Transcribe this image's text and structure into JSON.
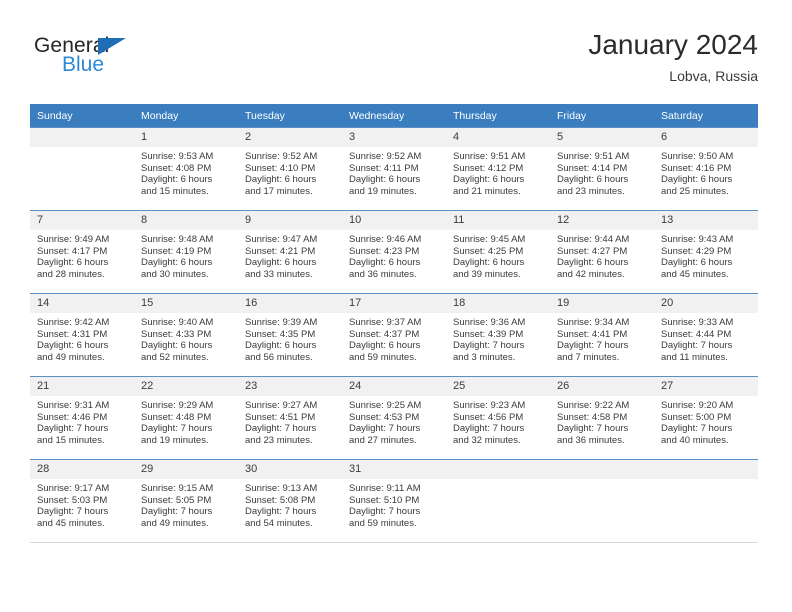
{
  "brand": {
    "word_one": "General",
    "word_two": "Blue",
    "triangle_color": "#1f6db5",
    "blue_color": "#2d89d6"
  },
  "header": {
    "title": "January 2024",
    "subtitle": "Lobva, Russia"
  },
  "theme": {
    "header_blue": "#3a7ec0",
    "daynum_gray": "#f1f1f1",
    "row_rule": "#5b8fc7"
  },
  "weekday_headers": [
    "Sunday",
    "Monday",
    "Tuesday",
    "Wednesday",
    "Thursday",
    "Friday",
    "Saturday"
  ],
  "labels": {
    "sunrise_prefix": "Sunrise:",
    "sunset_prefix": "Sunset:",
    "daylight_prefix": "Daylight:"
  },
  "weeks": [
    [
      {
        "day": "",
        "sunrise": "",
        "sunset": "",
        "daylight_line1": "",
        "daylight_line2": "",
        "empty": true
      },
      {
        "day": "1",
        "sunrise": "Sunrise: 9:53 AM",
        "sunset": "Sunset: 4:08 PM",
        "daylight_line1": "Daylight: 6 hours",
        "daylight_line2": "and 15 minutes."
      },
      {
        "day": "2",
        "sunrise": "Sunrise: 9:52 AM",
        "sunset": "Sunset: 4:10 PM",
        "daylight_line1": "Daylight: 6 hours",
        "daylight_line2": "and 17 minutes."
      },
      {
        "day": "3",
        "sunrise": "Sunrise: 9:52 AM",
        "sunset": "Sunset: 4:11 PM",
        "daylight_line1": "Daylight: 6 hours",
        "daylight_line2": "and 19 minutes."
      },
      {
        "day": "4",
        "sunrise": "Sunrise: 9:51 AM",
        "sunset": "Sunset: 4:12 PM",
        "daylight_line1": "Daylight: 6 hours",
        "daylight_line2": "and 21 minutes."
      },
      {
        "day": "5",
        "sunrise": "Sunrise: 9:51 AM",
        "sunset": "Sunset: 4:14 PM",
        "daylight_line1": "Daylight: 6 hours",
        "daylight_line2": "and 23 minutes."
      },
      {
        "day": "6",
        "sunrise": "Sunrise: 9:50 AM",
        "sunset": "Sunset: 4:16 PM",
        "daylight_line1": "Daylight: 6 hours",
        "daylight_line2": "and 25 minutes."
      }
    ],
    [
      {
        "day": "7",
        "sunrise": "Sunrise: 9:49 AM",
        "sunset": "Sunset: 4:17 PM",
        "daylight_line1": "Daylight: 6 hours",
        "daylight_line2": "and 28 minutes."
      },
      {
        "day": "8",
        "sunrise": "Sunrise: 9:48 AM",
        "sunset": "Sunset: 4:19 PM",
        "daylight_line1": "Daylight: 6 hours",
        "daylight_line2": "and 30 minutes."
      },
      {
        "day": "9",
        "sunrise": "Sunrise: 9:47 AM",
        "sunset": "Sunset: 4:21 PM",
        "daylight_line1": "Daylight: 6 hours",
        "daylight_line2": "and 33 minutes."
      },
      {
        "day": "10",
        "sunrise": "Sunrise: 9:46 AM",
        "sunset": "Sunset: 4:23 PM",
        "daylight_line1": "Daylight: 6 hours",
        "daylight_line2": "and 36 minutes."
      },
      {
        "day": "11",
        "sunrise": "Sunrise: 9:45 AM",
        "sunset": "Sunset: 4:25 PM",
        "daylight_line1": "Daylight: 6 hours",
        "daylight_line2": "and 39 minutes."
      },
      {
        "day": "12",
        "sunrise": "Sunrise: 9:44 AM",
        "sunset": "Sunset: 4:27 PM",
        "daylight_line1": "Daylight: 6 hours",
        "daylight_line2": "and 42 minutes."
      },
      {
        "day": "13",
        "sunrise": "Sunrise: 9:43 AM",
        "sunset": "Sunset: 4:29 PM",
        "daylight_line1": "Daylight: 6 hours",
        "daylight_line2": "and 45 minutes."
      }
    ],
    [
      {
        "day": "14",
        "sunrise": "Sunrise: 9:42 AM",
        "sunset": "Sunset: 4:31 PM",
        "daylight_line1": "Daylight: 6 hours",
        "daylight_line2": "and 49 minutes."
      },
      {
        "day": "15",
        "sunrise": "Sunrise: 9:40 AM",
        "sunset": "Sunset: 4:33 PM",
        "daylight_line1": "Daylight: 6 hours",
        "daylight_line2": "and 52 minutes."
      },
      {
        "day": "16",
        "sunrise": "Sunrise: 9:39 AM",
        "sunset": "Sunset: 4:35 PM",
        "daylight_line1": "Daylight: 6 hours",
        "daylight_line2": "and 56 minutes."
      },
      {
        "day": "17",
        "sunrise": "Sunrise: 9:37 AM",
        "sunset": "Sunset: 4:37 PM",
        "daylight_line1": "Daylight: 6 hours",
        "daylight_line2": "and 59 minutes."
      },
      {
        "day": "18",
        "sunrise": "Sunrise: 9:36 AM",
        "sunset": "Sunset: 4:39 PM",
        "daylight_line1": "Daylight: 7 hours",
        "daylight_line2": "and 3 minutes."
      },
      {
        "day": "19",
        "sunrise": "Sunrise: 9:34 AM",
        "sunset": "Sunset: 4:41 PM",
        "daylight_line1": "Daylight: 7 hours",
        "daylight_line2": "and 7 minutes."
      },
      {
        "day": "20",
        "sunrise": "Sunrise: 9:33 AM",
        "sunset": "Sunset: 4:44 PM",
        "daylight_line1": "Daylight: 7 hours",
        "daylight_line2": "and 11 minutes."
      }
    ],
    [
      {
        "day": "21",
        "sunrise": "Sunrise: 9:31 AM",
        "sunset": "Sunset: 4:46 PM",
        "daylight_line1": "Daylight: 7 hours",
        "daylight_line2": "and 15 minutes."
      },
      {
        "day": "22",
        "sunrise": "Sunrise: 9:29 AM",
        "sunset": "Sunset: 4:48 PM",
        "daylight_line1": "Daylight: 7 hours",
        "daylight_line2": "and 19 minutes."
      },
      {
        "day": "23",
        "sunrise": "Sunrise: 9:27 AM",
        "sunset": "Sunset: 4:51 PM",
        "daylight_line1": "Daylight: 7 hours",
        "daylight_line2": "and 23 minutes."
      },
      {
        "day": "24",
        "sunrise": "Sunrise: 9:25 AM",
        "sunset": "Sunset: 4:53 PM",
        "daylight_line1": "Daylight: 7 hours",
        "daylight_line2": "and 27 minutes."
      },
      {
        "day": "25",
        "sunrise": "Sunrise: 9:23 AM",
        "sunset": "Sunset: 4:56 PM",
        "daylight_line1": "Daylight: 7 hours",
        "daylight_line2": "and 32 minutes."
      },
      {
        "day": "26",
        "sunrise": "Sunrise: 9:22 AM",
        "sunset": "Sunset: 4:58 PM",
        "daylight_line1": "Daylight: 7 hours",
        "daylight_line2": "and 36 minutes."
      },
      {
        "day": "27",
        "sunrise": "Sunrise: 9:20 AM",
        "sunset": "Sunset: 5:00 PM",
        "daylight_line1": "Daylight: 7 hours",
        "daylight_line2": "and 40 minutes."
      }
    ],
    [
      {
        "day": "28",
        "sunrise": "Sunrise: 9:17 AM",
        "sunset": "Sunset: 5:03 PM",
        "daylight_line1": "Daylight: 7 hours",
        "daylight_line2": "and 45 minutes."
      },
      {
        "day": "29",
        "sunrise": "Sunrise: 9:15 AM",
        "sunset": "Sunset: 5:05 PM",
        "daylight_line1": "Daylight: 7 hours",
        "daylight_line2": "and 49 minutes."
      },
      {
        "day": "30",
        "sunrise": "Sunrise: 9:13 AM",
        "sunset": "Sunset: 5:08 PM",
        "daylight_line1": "Daylight: 7 hours",
        "daylight_line2": "and 54 minutes."
      },
      {
        "day": "31",
        "sunrise": "Sunrise: 9:11 AM",
        "sunset": "Sunset: 5:10 PM",
        "daylight_line1": "Daylight: 7 hours",
        "daylight_line2": "and 59 minutes."
      },
      {
        "day": "",
        "sunrise": "",
        "sunset": "",
        "daylight_line1": "",
        "daylight_line2": "",
        "empty": true
      },
      {
        "day": "",
        "sunrise": "",
        "sunset": "",
        "daylight_line1": "",
        "daylight_line2": "",
        "empty": true
      },
      {
        "day": "",
        "sunrise": "",
        "sunset": "",
        "daylight_line1": "",
        "daylight_line2": "",
        "empty": true
      }
    ]
  ]
}
